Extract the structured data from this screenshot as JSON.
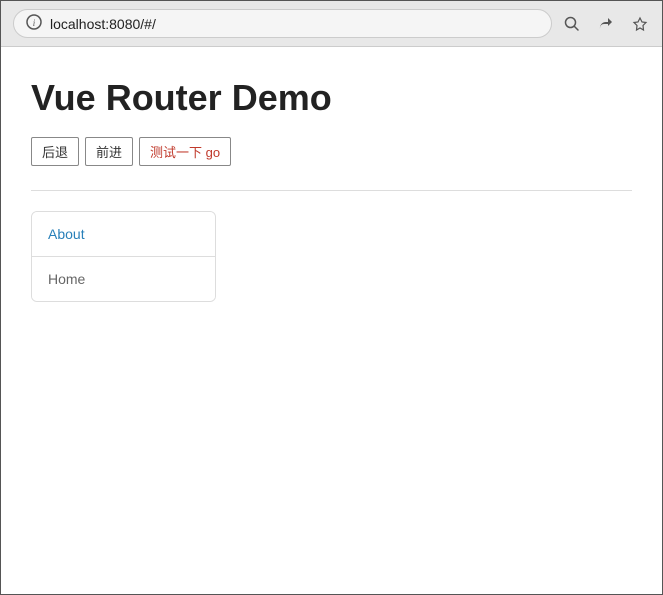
{
  "browser": {
    "address": "localhost:8080/#/",
    "icons": {
      "search": "🔍",
      "share": "↗",
      "bookmark": "☆"
    }
  },
  "page": {
    "title": "Vue Router Demo",
    "buttons": [
      {
        "id": "back",
        "label": "后退"
      },
      {
        "id": "forward",
        "label": "前进"
      },
      {
        "id": "go",
        "label": "测试一下 go"
      }
    ],
    "routes": [
      {
        "id": "about",
        "label": "About",
        "active": true
      },
      {
        "id": "home",
        "label": "Home",
        "active": false
      }
    ]
  }
}
